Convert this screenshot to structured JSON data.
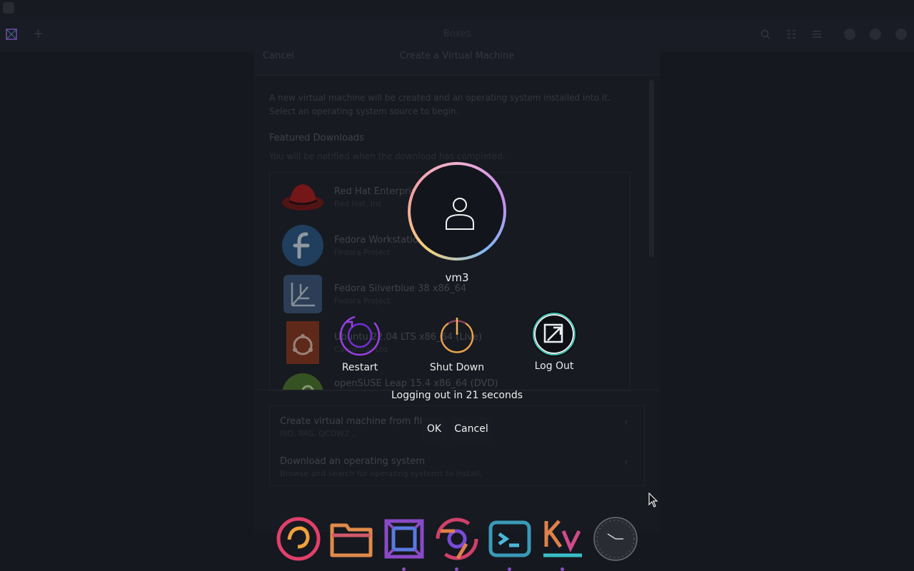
{
  "app": {
    "title": "Boxes"
  },
  "dialog": {
    "cancel_label": "Cancel",
    "title": "Create a Virtual Machine",
    "intro_line1": "A new virtual machine will be created and an operating system installed into it.",
    "intro_line2": "Select an operating system source to begin.",
    "featured_heading": "Featured Downloads",
    "featured_subtitle": "You will be notified when the download has completed.",
    "os_items": [
      {
        "name": "Red Hat Enterprise Linux",
        "vendor": "Red Hat, Inc"
      },
      {
        "name": "Fedora Workstation 38 x86_64",
        "vendor": "Fedora Project"
      },
      {
        "name": "Fedora Silverblue 38 x86_64",
        "vendor": "Fedora Project"
      },
      {
        "name": "Ubuntu 22.04 LTS x86_64 (Live)",
        "vendor": "Canonical Ltd"
      },
      {
        "name": "openSUSE Leap 15.4 x86_64 (DVD)",
        "vendor": ""
      }
    ],
    "options": [
      {
        "title": "Create virtual machine from file",
        "subtitle": "ISO, IMG, QCOW2..."
      },
      {
        "title": "Download an operating system",
        "subtitle": "Browse and search for operating systems to install."
      }
    ]
  },
  "logout": {
    "username": "vm3",
    "actions": {
      "restart": "Restart",
      "shutdown": "Shut Down",
      "logout": "Log Out"
    },
    "countdown_text": "Logging out in 21 seconds",
    "ok_label": "OK",
    "cancel_label": "Cancel"
  },
  "dock": {
    "items": [
      "firefox-icon",
      "files-icon",
      "boxes-icon",
      "chrome-icon",
      "terminal-icon",
      "kvantum-icon",
      "clock-icon"
    ]
  },
  "colors": {
    "background": "#1c1f27",
    "avatar_ring": "#c78cf2",
    "log_out_accent": "#3fe0c8",
    "restart_accent": "#9a3fe8"
  }
}
